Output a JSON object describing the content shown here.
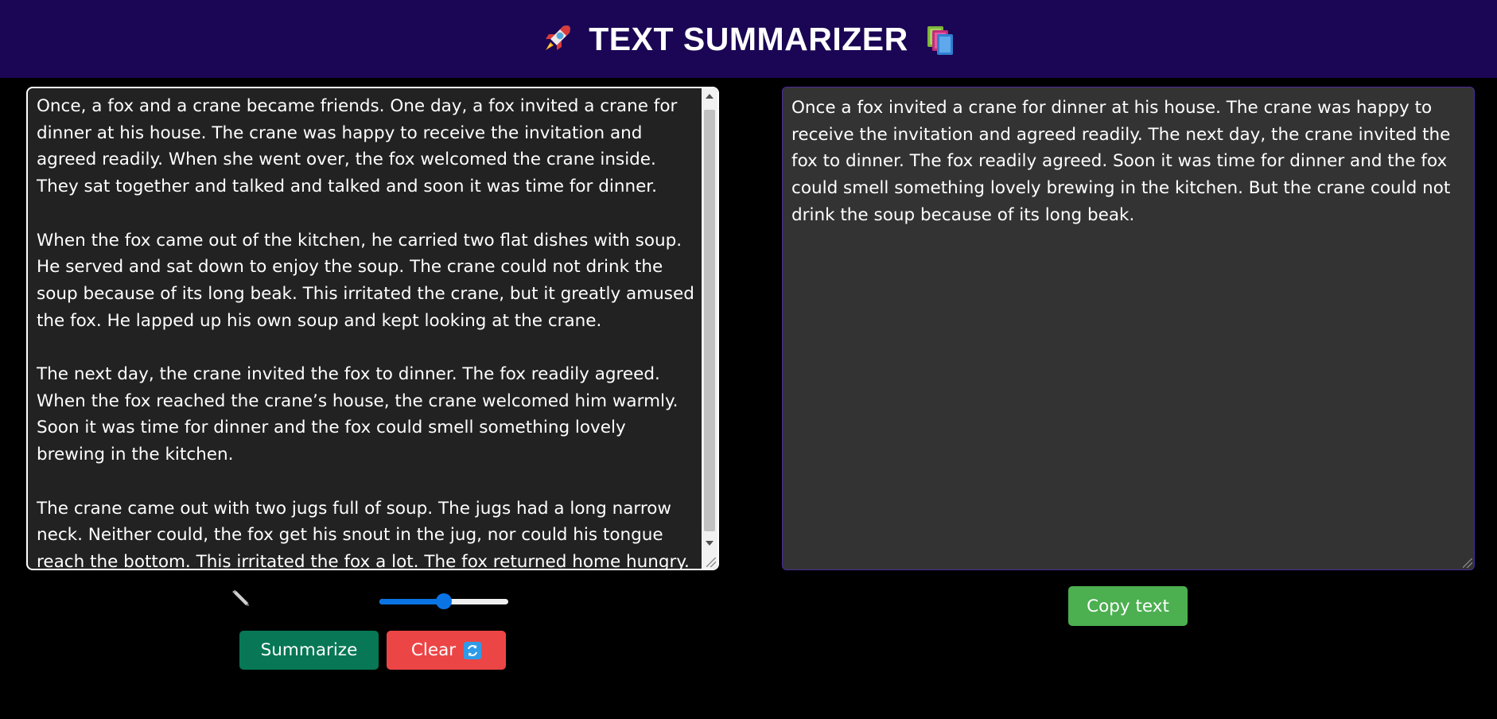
{
  "header": {
    "title": "TEXT SUMMARIZER",
    "left_icon": "rocket-icon",
    "right_icon": "books-icon",
    "background": "#1a0654"
  },
  "input": {
    "text": "Once, a fox and a crane became friends. One day, a fox invited a crane for dinner at his house. The crane was happy to receive the invitation and agreed readily. When she went over, the fox welcomed the crane inside. They sat together and talked and talked and soon it was time for dinner.\n\nWhen the fox came out of the kitchen, he carried two flat dishes with soup. He served and sat down to enjoy the soup. The crane could not drink the soup because of its long beak. This irritated the crane, but it greatly amused the fox. He lapped up his own soup and kept looking at the crane.\n\nThe next day, the crane invited the fox to dinner. The fox readily agreed. When the fox reached the crane’s house, the crane welcomed him warmly. Soon it was time for dinner and the fox could smell something lovely brewing in the kitchen.\n\nThe crane came out with two jugs full of soup. The jugs had a long narrow neck. Neither could, the fox get his snout in the jug, nor could his tongue reach the bottom. This irritated the fox a lot. The fox returned home hungry. Now he realized that he had been repaid for his behaviour with the crane."
  },
  "output": {
    "text": "Once a fox invited a crane for dinner at his house. The crane was happy to receive the invitation and agreed readily. The next day, the crane invited the fox to dinner. The fox readily agreed. Soon it was time for dinner and the fox could smell something lovely brewing in the kitchen. But the crane could not drink the soup because of its long beak."
  },
  "controls": {
    "pencil_icon": "pencil-icon",
    "slider_value_fraction": 0.5,
    "summarize_label": "Summarize",
    "clear_label": "Clear",
    "clear_icon": "refresh-icon",
    "copy_label": "Copy text"
  },
  "colors": {
    "summarize": "#077755",
    "clear": "#ec4546",
    "copy": "#4caf50",
    "slider": "#0b74e5"
  }
}
